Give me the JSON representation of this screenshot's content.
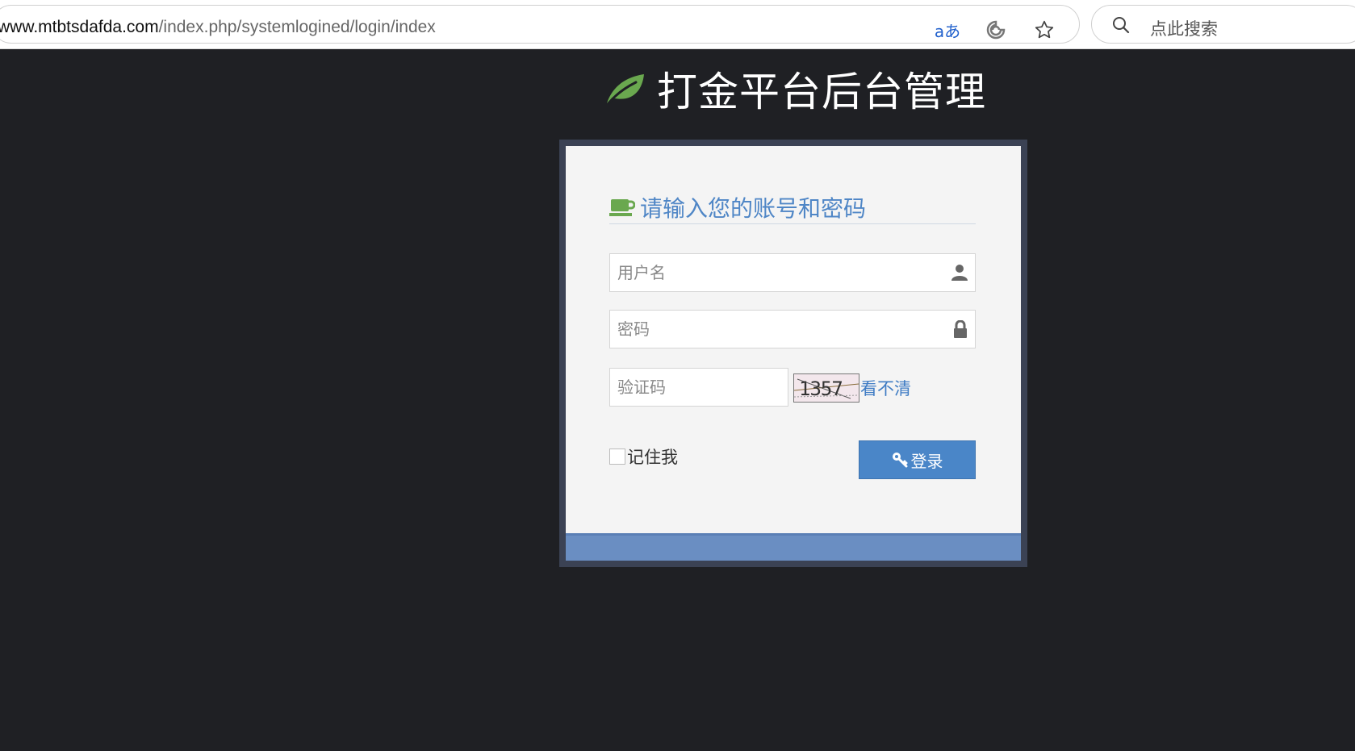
{
  "browser": {
    "url_domain": "www.mtbtsdafda.com",
    "url_path": "/index.php/systemlogined/login/index",
    "translate_label": "aあ",
    "search_placeholder": "点此搜索"
  },
  "brand": {
    "title": "打金平台后台管理",
    "icon": "leaf-icon",
    "accent": "#6aa84f"
  },
  "login": {
    "heading": "请输入您的账号和密码",
    "username_placeholder": "用户名",
    "password_placeholder": "密码",
    "captcha_placeholder": "验证码",
    "captcha_text": "1357",
    "captcha_refresh": "看不清",
    "remember_label": "记住我",
    "login_label": "登录",
    "colors": {
      "heading": "#4f86c6",
      "button": "#4a86c8",
      "footer": "#6a8ec2",
      "frame": "#3b4254",
      "page_bg": "#1f2024"
    }
  }
}
